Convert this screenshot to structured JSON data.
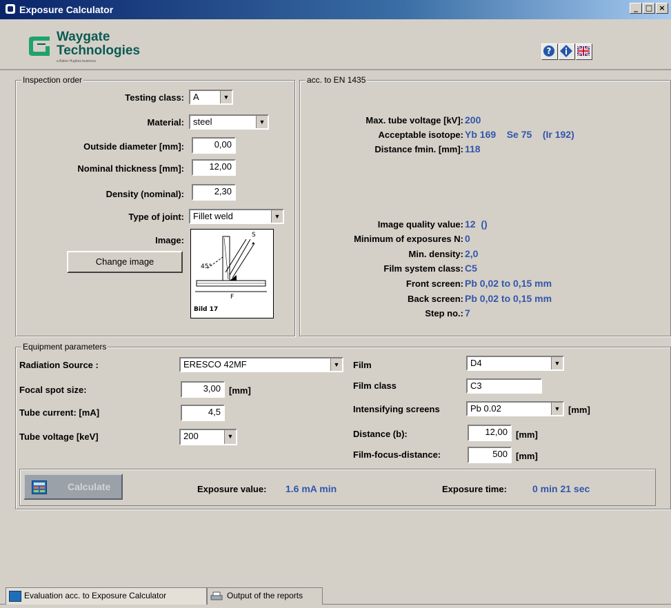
{
  "window": {
    "title": "Exposure Calculator",
    "min": "_",
    "max": "□",
    "close": "×"
  },
  "logo": {
    "line1": "Waygate",
    "line2": "Technologies",
    "sub": "a Baker Hughes business"
  },
  "inspection": {
    "legend": "Inspection order",
    "testing_class_label": "Testing class:",
    "testing_class_value": "A",
    "material_label": "Material:",
    "material_value": "steel",
    "outside_diameter_label": "Outside diameter [mm]:",
    "outside_diameter_value": "0,00",
    "nominal_thickness_label": "Nominal thickness [mm]:",
    "nominal_thickness_value": "12,00",
    "density_label": "Density (nominal):",
    "density_value": "2,30",
    "joint_label": "Type of joint:",
    "joint_value": "Fillet weld",
    "image_label": "Image:",
    "change_image": "Change image",
    "image_caption": "Bild 17"
  },
  "en1435": {
    "legend": "acc. to EN 1435",
    "max_tube_label": "Max. tube voltage [kV]:",
    "max_tube_value": "200",
    "isotope_label": "Acceptable isotope:",
    "isotope_value": "Yb 169    Se 75    (Ir 192)",
    "fmin_label": "Distance fmin. [mm]:",
    "fmin_value": "118",
    "iq_label": "Image quality value:",
    "iq_value": "12  ()",
    "min_exp_label": "Minimum of exposures N:",
    "min_exp_value": "0",
    "min_density_label": "Min. density:",
    "min_density_value": "2,0",
    "film_class_label": "Film system class:",
    "film_class_value": "C5",
    "front_label": "Front screen:",
    "front_value": "Pb 0,02 to 0,15 mm",
    "back_label": "Back screen:",
    "back_value": "Pb 0,02 to 0,15 mm",
    "step_label": "Step no.:",
    "step_value": "7"
  },
  "equipment": {
    "legend": "Equipment parameters",
    "source_label": "Radiation Source :",
    "source_value": "ERESCO 42MF",
    "focal_label": "Focal spot size:",
    "focal_value": "3,00",
    "focal_unit": "[mm]",
    "current_label": "Tube current: [mA]",
    "current_value": "4,5",
    "voltage_label": "Tube voltage [keV]",
    "voltage_value": "200",
    "film_label": "Film",
    "film_value": "D4",
    "film_class_label": "Film class",
    "film_class_value": "C3",
    "screens_label": "Intensifying screens",
    "screens_value": "Pb 0.02",
    "screens_unit": "[mm]",
    "distance_label": "Distance (b):",
    "distance_value": "12,00",
    "distance_unit": "[mm]",
    "ffd_label": "Film-focus-distance:",
    "ffd_value": "500",
    "ffd_unit": "[mm]"
  },
  "result": {
    "calculate": "Calculate",
    "exposure_label": "Exposure value:",
    "exposure_value": "1.6 mA min",
    "time_label": "Exposure time:",
    "time_value": "0 min 21 sec"
  },
  "tabs": [
    {
      "label": "Evaluation acc. to Exposure Calculator"
    },
    {
      "label": "Output of the reports"
    }
  ],
  "colors": {
    "value_blue": "#3355aa",
    "brand_teal": "#0b5a52",
    "title_bar": "#0a246a"
  }
}
